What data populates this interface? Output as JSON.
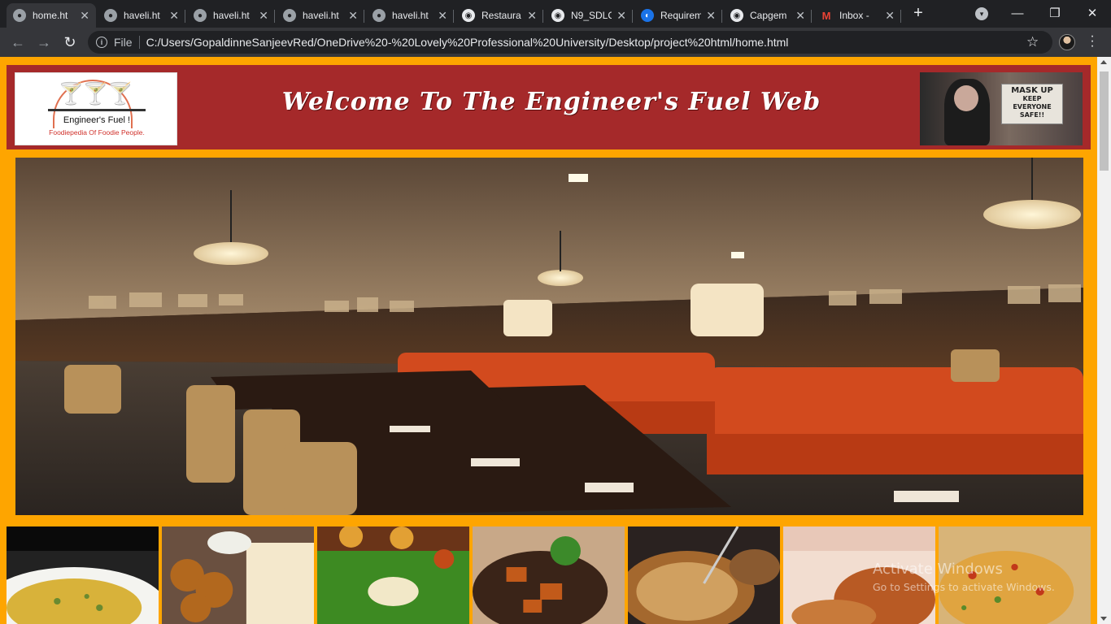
{
  "browser": {
    "tabs": [
      {
        "title": "home.ht",
        "icon": "globe-icon",
        "active": true
      },
      {
        "title": "haveli.ht",
        "icon": "globe-icon",
        "active": false
      },
      {
        "title": "haveli.ht",
        "icon": "globe-icon",
        "active": false
      },
      {
        "title": "haveli.ht",
        "icon": "globe-icon",
        "active": false
      },
      {
        "title": "haveli.ht",
        "icon": "globe-icon",
        "active": false
      },
      {
        "title": "Restaura",
        "icon": "github-icon",
        "active": false
      },
      {
        "title": "N9_SDLC",
        "icon": "github-icon",
        "active": false
      },
      {
        "title": "Requirem",
        "icon": "app-icon",
        "active": false
      },
      {
        "title": "Capgem",
        "icon": "github-icon",
        "active": false
      },
      {
        "title": "Inbox - ",
        "icon": "gmail-icon",
        "active": false
      }
    ],
    "address": {
      "security_label": "File",
      "url": "C:/Users/GopaldinneSanjeevRed/OneDrive%20-%20Lovely%20Professional%20University/Desktop/project%20html/home.html"
    }
  },
  "page": {
    "logo": {
      "name": "Engineer's Fuel !",
      "tagline": "Foodiepedia Of Foodie People."
    },
    "welcome_title": "Welcome To The Engineer's Fuel Web",
    "mask_sign": {
      "line1": "MASK UP",
      "line2": "KEEP",
      "line3": "EVERYONE",
      "line4": "SAFE!!"
    },
    "hero_alt": "restaurant interior",
    "gallery": [
      "pulao",
      "vada-dosa",
      "banana-leaf-meal",
      "chilli-paneer",
      "noodles",
      "chicken-leg",
      "biryani"
    ],
    "colors": {
      "background": "#fea500",
      "header": "#a5292a"
    }
  },
  "os_overlay": {
    "line1": "Activate Windows",
    "line2": "Go to Settings to activate Windows."
  }
}
